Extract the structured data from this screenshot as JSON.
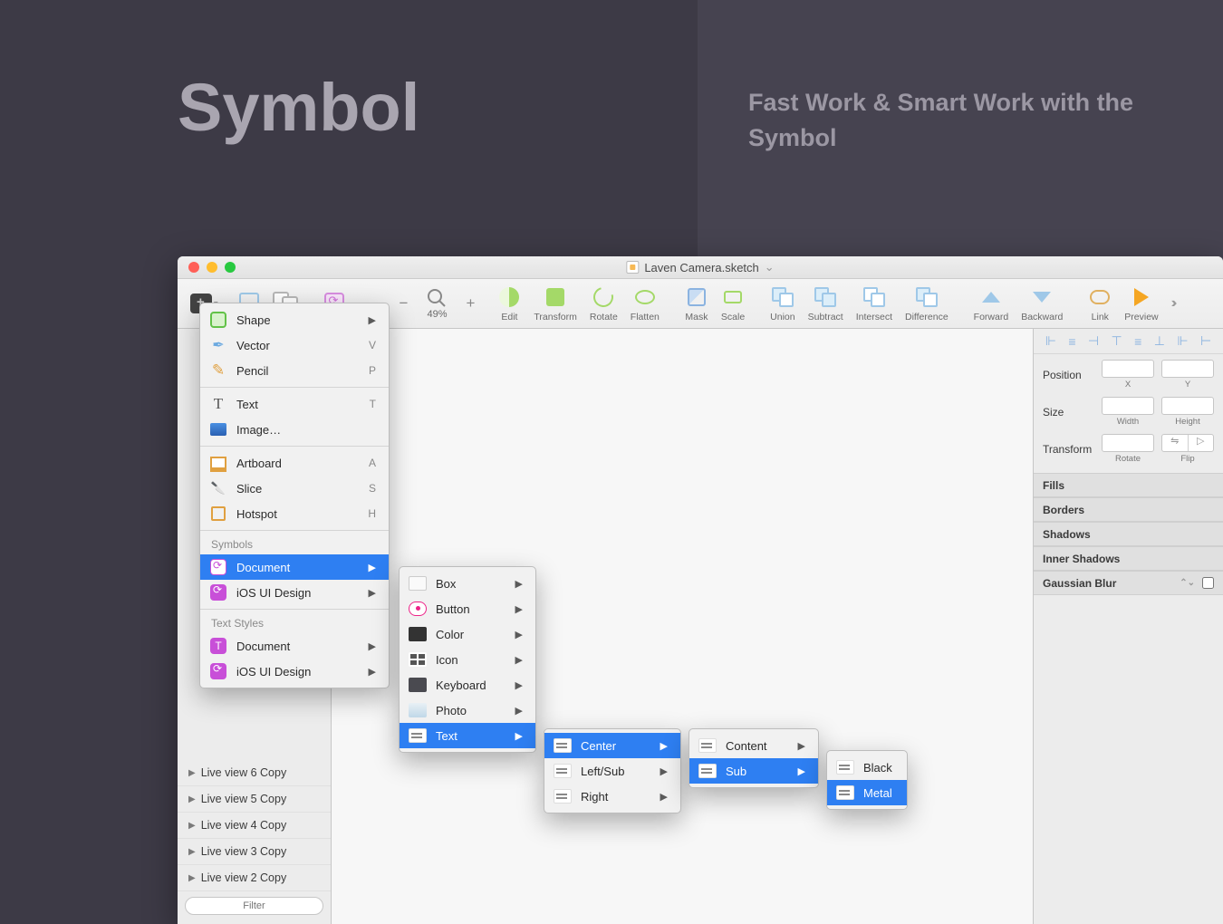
{
  "hero": {
    "title": "Symbol",
    "subtitle": "Fast Work & Smart Work with the Symbol"
  },
  "window": {
    "title": "Laven Camera.sketch"
  },
  "toolbar": {
    "zoom": "49%",
    "items": [
      "Edit",
      "Transform",
      "Rotate",
      "Flatten",
      "Mask",
      "Scale",
      "Union",
      "Subtract",
      "Intersect",
      "Difference",
      "Forward",
      "Backward",
      "Link",
      "Preview"
    ]
  },
  "insert_menu": {
    "shape": "Shape",
    "vector": "Vector",
    "pencil": "Pencil",
    "text": "Text",
    "image": "Image…",
    "artboard": "Artboard",
    "slice": "Slice",
    "hotspot": "Hotspot",
    "symbols_hdr": "Symbols",
    "document": "Document",
    "ios": "iOS UI Design",
    "text_styles_hdr": "Text Styles",
    "ts_doc": "Document",
    "ts_ios": "iOS UI Design",
    "sc": {
      "vector": "V",
      "pencil": "P",
      "text": "T",
      "artboard": "A",
      "slice": "S",
      "hotspot": "H"
    }
  },
  "submenu2": {
    "items": [
      "Box",
      "Button",
      "Color",
      "Icon",
      "Keyboard",
      "Photo",
      "Text"
    ]
  },
  "submenu3": {
    "items": [
      "Center",
      "Left/Sub",
      "Right"
    ]
  },
  "submenu4": {
    "items": [
      "Content",
      "Sub"
    ]
  },
  "submenu5": {
    "items": [
      "Black",
      "Metal"
    ]
  },
  "layers": [
    "Live view 6 Copy",
    "Live view 5 Copy",
    "Live view 4 Copy",
    "Live view 3 Copy",
    "Live view 2 Copy"
  ],
  "filter_placeholder": "Filter",
  "inspector": {
    "position": "Position",
    "x": "X",
    "y": "Y",
    "size": "Size",
    "w": "Width",
    "h": "Height",
    "transform": "Transform",
    "rotate": "Rotate",
    "flip": "Flip",
    "fills": "Fills",
    "borders": "Borders",
    "shadows": "Shadows",
    "inner": "Inner Shadows",
    "blur": "Gaussian Blur"
  }
}
